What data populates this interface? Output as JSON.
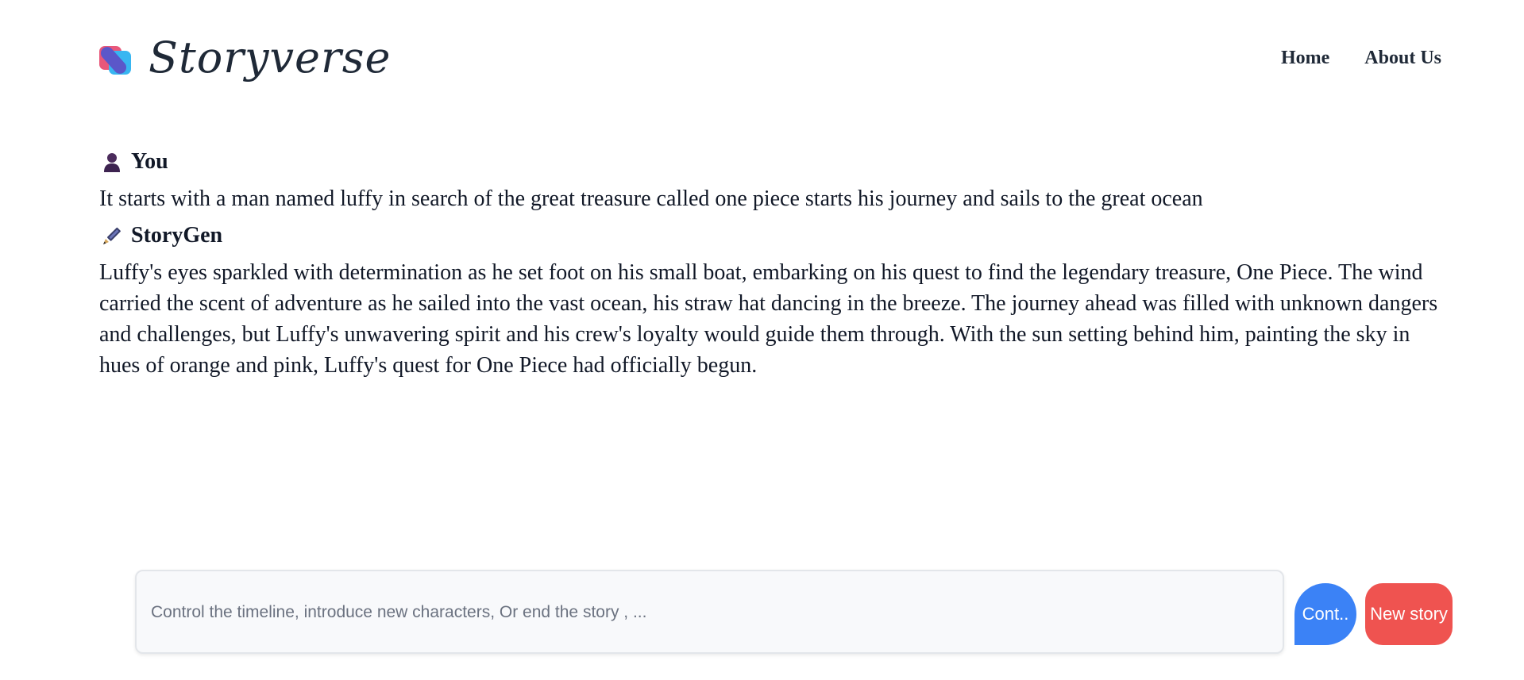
{
  "brand": {
    "name": "Storyverse",
    "logo_icon": "storyverse-logo-icon",
    "colors": {
      "pink": "#e8577a",
      "blue": "#38b6f1",
      "purple": "#5b57c9"
    }
  },
  "nav": {
    "home": "Home",
    "about": "About Us"
  },
  "conversation": [
    {
      "speaker": "You",
      "icon": "user-silhouette-icon",
      "text": "It starts with a man named luffy in search of the great treasure called one piece starts his journey and sails to the great ocean"
    },
    {
      "speaker": "StoryGen",
      "icon": "pen-nib-icon",
      "text": "Luffy's eyes sparkled with determination as he set foot on his small boat, embarking on his quest to find the legendary treasure, One Piece. The wind carried the scent of adventure as he sailed into the vast ocean, his straw hat dancing in the breeze. The journey ahead was filled with unknown dangers and challenges, but Luffy's unwavering spirit and his crew's loyalty would guide them through. With the sun setting behind him, painting the sky in hues of orange and pink, Luffy's quest for One Piece had officially begun."
    }
  ],
  "composer": {
    "placeholder": "Control the timeline, introduce new characters, Or end the story , ...",
    "value": ""
  },
  "actions": {
    "continue_label": "Cont..",
    "new_story_label": "New story",
    "continue_color": "#3b82f6",
    "new_story_color": "#ef5350"
  }
}
